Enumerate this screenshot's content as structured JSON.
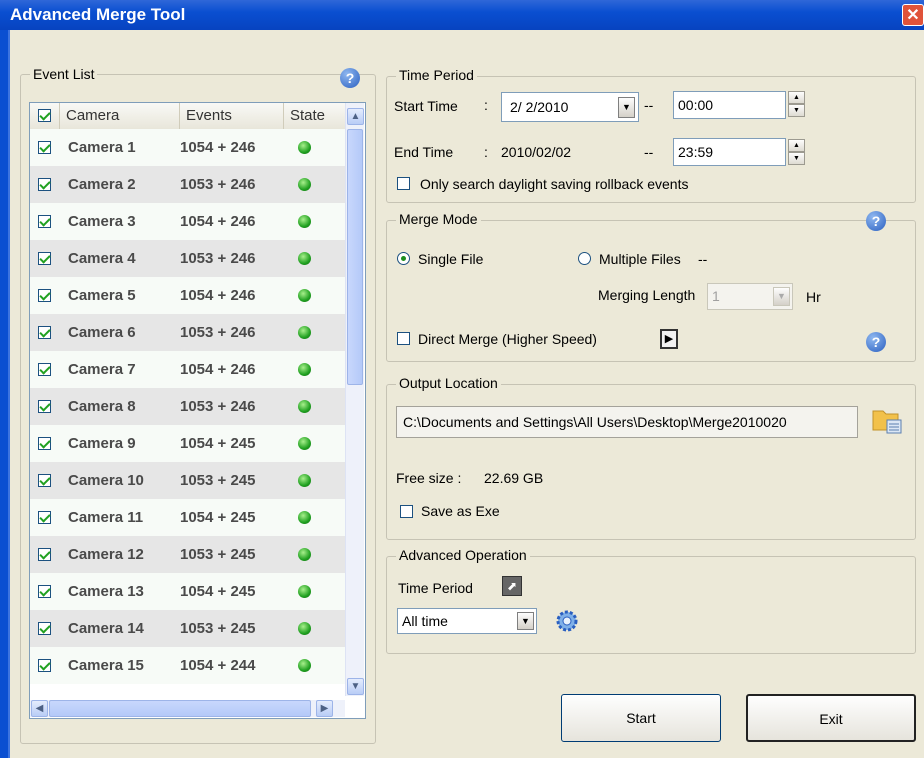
{
  "window": {
    "title": "Advanced Merge Tool",
    "close_glyph": "✕"
  },
  "event_list": {
    "legend": "Event List",
    "help_glyph": "?",
    "columns": [
      "Camera",
      "Events",
      "State"
    ],
    "rows": [
      {
        "camera": "Camera 1",
        "events": "1054 + 246",
        "state": "green"
      },
      {
        "camera": "Camera 2",
        "events": "1053 + 246",
        "state": "green"
      },
      {
        "camera": "Camera 3",
        "events": "1054 + 246",
        "state": "green"
      },
      {
        "camera": "Camera 4",
        "events": "1053 + 246",
        "state": "green"
      },
      {
        "camera": "Camera 5",
        "events": "1054 + 246",
        "state": "green"
      },
      {
        "camera": "Camera 6",
        "events": "1053 + 246",
        "state": "green"
      },
      {
        "camera": "Camera 7",
        "events": "1054 + 246",
        "state": "green"
      },
      {
        "camera": "Camera 8",
        "events": "1053 + 246",
        "state": "green"
      },
      {
        "camera": "Camera 9",
        "events": "1054 + 245",
        "state": "green"
      },
      {
        "camera": "Camera 10",
        "events": "1053 + 245",
        "state": "green"
      },
      {
        "camera": "Camera 11",
        "events": "1054 + 245",
        "state": "green"
      },
      {
        "camera": "Camera 12",
        "events": "1053 + 245",
        "state": "green"
      },
      {
        "camera": "Camera 13",
        "events": "1054 + 245",
        "state": "green"
      },
      {
        "camera": "Camera 14",
        "events": "1053 + 245",
        "state": "green"
      },
      {
        "camera": "Camera 15",
        "events": "1054 + 244",
        "state": "green"
      }
    ]
  },
  "time_period": {
    "legend": "Time Period",
    "start_label": "Start Time",
    "start_colon": ":",
    "start_date": "2/ 2/2010",
    "dash1": "--",
    "start_time": "00:00",
    "end_label": "End Time",
    "end_colon": ":",
    "end_date": "2010/02/02",
    "dash2": "--",
    "end_time": "23:59",
    "daylight_label": "Only search daylight saving rollback events"
  },
  "merge_mode": {
    "legend": "Merge Mode",
    "single_label": "Single File",
    "multiple_label": "Multiple Files",
    "multiple_dash": "--",
    "length_label": "Merging Length",
    "length_value": "1",
    "length_unit": "Hr",
    "direct_label": "Direct Merge (Higher Speed)"
  },
  "output": {
    "legend": "Output Location",
    "path": "C:\\Documents and Settings\\All Users\\Desktop\\Merge2010020",
    "free_label": "Free size :",
    "free_value": "22.69 GB",
    "save_exe_label": "Save as Exe"
  },
  "advanced": {
    "legend": "Advanced Operation",
    "time_period_label": "Time Period",
    "select_value": "All time"
  },
  "buttons": {
    "start": "Start",
    "exit": "Exit"
  }
}
